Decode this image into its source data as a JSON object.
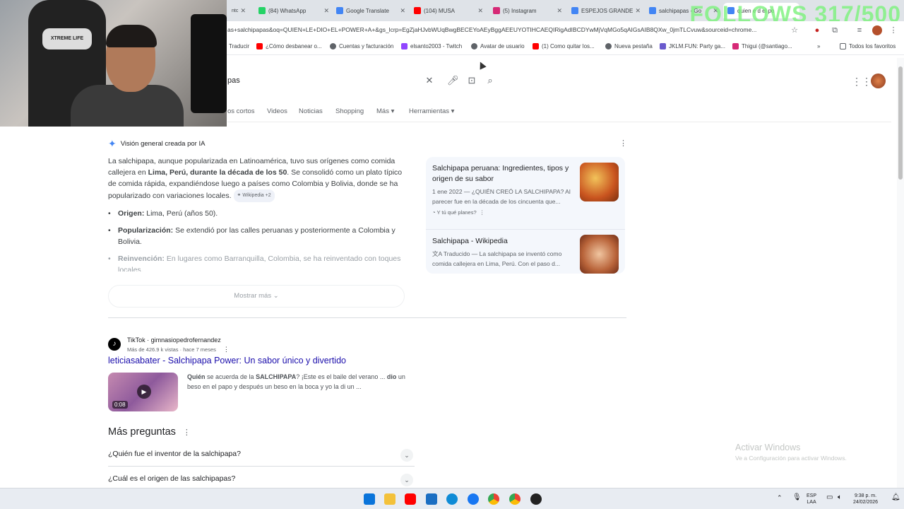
{
  "overlay": {
    "follows": "FOLLOWS 317/500"
  },
  "browser": {
    "tabs": [
      {
        "label": "(84) WhatsApp",
        "color": "#25d366"
      },
      {
        "label": "Google Translate",
        "color": "#4285f4"
      },
      {
        "label": "(104) MUSA",
        "color": "#ff0000"
      },
      {
        "label": "(5) Instagram",
        "color": "#d62976"
      },
      {
        "label": "ESPEJOS GRANDE",
        "color": "#4285f4"
      },
      {
        "label": "salchipapas - Go",
        "color": "#4285f4"
      },
      {
        "label": "quien e d el po",
        "color": "#4285f4"
      }
    ],
    "url": "as+salchipapas&oq=QUIEN+LE+DIO+EL+POWER+A+&gs_lcrp=EgZjaHJvbWUqBwgBECEYoAEyBggAEEUYOTIHCAEQIRigAdIBCDYwMjVqMGo5qAIGsAIB8QXw_0jmTLCvuw&sourceid=chrome...",
    "bookmarks": [
      {
        "label": "Traducir",
        "color": "#4285f4"
      },
      {
        "label": "¿Cómo desbanear o...",
        "color": "#ff0000"
      },
      {
        "label": "Cuentas y facturación",
        "color": "#5f6368"
      },
      {
        "label": "elsanto2003 - Twitch",
        "color": "#9146ff"
      },
      {
        "label": "Avatar de usuario",
        "color": "#5f6368"
      },
      {
        "label": "(1) Como quitar los...",
        "color": "#ff0000"
      },
      {
        "label": "Nueva pestaña",
        "color": "#5f6368"
      },
      {
        "label": "JKLM.FUN: Party ga...",
        "color": "#6a5acd"
      },
      {
        "label": "Thigui (@santiago...",
        "color": "#d62976"
      },
      {
        "label": "Todos los favoritos",
        "color": "#5f6368"
      }
    ]
  },
  "search": {
    "query": "pas",
    "tabs": [
      "os cortos",
      "Videos",
      "Noticias",
      "Shopping",
      "Más",
      "Herramientas"
    ]
  },
  "ai_overview": {
    "heading": "Visión general creada por IA",
    "p1_a": "La salchipapa, aunque popularizada en Latinoamérica, tuvo sus orígenes como comida callejera en ",
    "p1_bold": "Lima, Perú, durante la década de los 50",
    "p1_b": ". Se consolidó como un plato típico de comida rápida, expandiéndose luego a países como Colombia y Bolivia, donde se ha popularizado con variaciones locales.",
    "p1_chip": "Wikipedia +2",
    "bullets": [
      {
        "label": "Origen:",
        "text": " Lima, Perú (años 50)."
      },
      {
        "label": "Popularización:",
        "text": " Se extendió por las calles peruanas y posteriormente a Colombia y Bolivia."
      },
      {
        "label": "Reinvención:",
        "text": " En lugares como Barranquilla, Colombia, se ha reinventado con toques locales."
      }
    ],
    "show_more": "Mostrar más",
    "sources": [
      {
        "title": "Salchipapa peruana: Ingredientes, tipos y origen de su sabor",
        "snippet": "1 ene 2022 — ¿QUIÉN CREÓ LA SALCHIPAPA? Al parecer fue en la década de los cincuenta que...",
        "site": "Y tú qué planes?"
      },
      {
        "title": "Salchipapa - Wikipedia",
        "snippet": "Traducido — La salchipapa se inventó como comida callejera en Lima, Perú. Con el paso d..."
      }
    ]
  },
  "result": {
    "source": "TikTok · gimnasiopedrofernandez",
    "meta": "Más de 426.9 k vistas · hace 7 meses",
    "title": "leticiasabater - Salchipapa Power: Un sabor único y divertido",
    "duration": "0:08",
    "snippet_b1": "Quién",
    "snippet_t1": " se acuerda de la ",
    "snippet_b2": "SALCHIPAPA",
    "snippet_t2": "? ¡Este es el baile del verano ... ",
    "snippet_b3": "dio",
    "snippet_t3": " un beso en el papo y después un beso en la boca y yo la di un ..."
  },
  "more_questions": {
    "title": "Más preguntas",
    "items": [
      "¿Quién fue el inventor de la salchipapa?",
      "¿Cuál es el origen de las salchipapas?"
    ]
  },
  "windows": {
    "activate_title": "Activar Windows",
    "activate_sub": "Ve a Configuración para activar Windows.",
    "lang1": "ESP",
    "lang2": "LAA",
    "time": "9:38 p. m.",
    "date": "24/02/2026"
  }
}
